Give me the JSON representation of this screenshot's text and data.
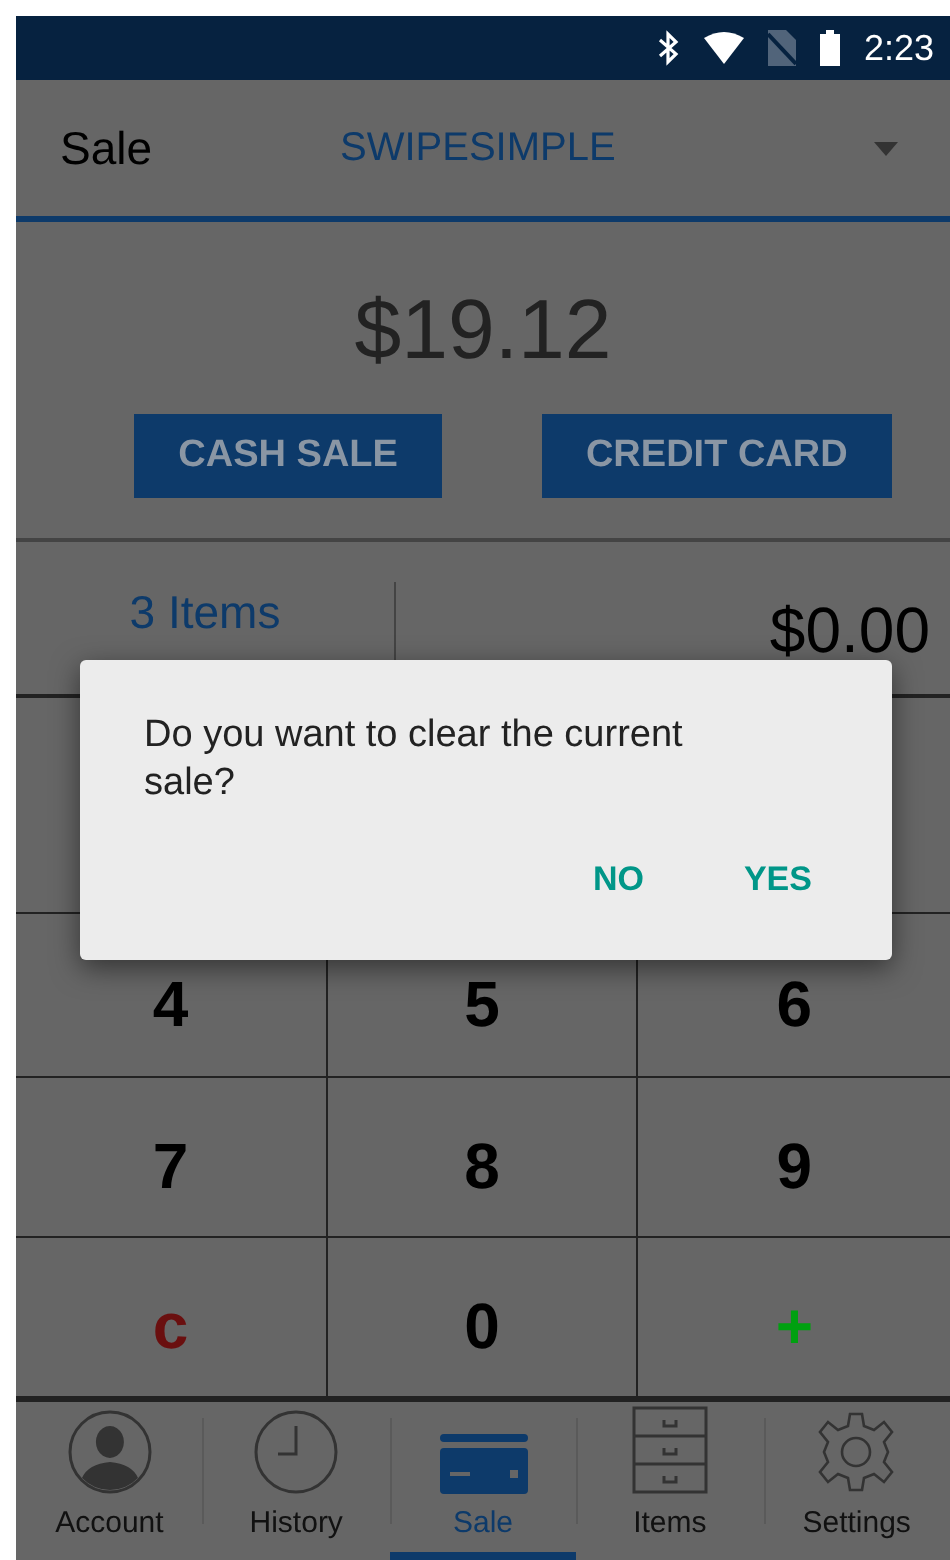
{
  "status_bar": {
    "time": "2:23"
  },
  "toolbar": {
    "title": "Sale",
    "account_selector": "SWIPESIMPLE"
  },
  "amount": "$19.12",
  "sale_buttons": [
    "CASH SALE",
    "CREDIT CARD"
  ],
  "summary": {
    "items": "3 Items",
    "total": "$0.00"
  },
  "keypad": [
    {
      "kind": "digit",
      "label": "4"
    },
    {
      "kind": "digit",
      "label": "5"
    },
    {
      "kind": "digit",
      "label": "6"
    },
    {
      "kind": "digit",
      "label": "7"
    },
    {
      "kind": "digit",
      "label": "8"
    },
    {
      "kind": "digit",
      "label": "9"
    },
    {
      "kind": "clear",
      "label": "c"
    },
    {
      "kind": "digit",
      "label": "0"
    },
    {
      "kind": "add",
      "label": "+"
    }
  ],
  "tabs": [
    {
      "kind": "account",
      "label": "Account",
      "selected": false
    },
    {
      "kind": "history",
      "label": "History",
      "selected": false
    },
    {
      "kind": "sale",
      "label": "Sale",
      "selected": true
    },
    {
      "kind": "items",
      "label": "Items",
      "selected": false
    },
    {
      "kind": "settings",
      "label": "Settings",
      "selected": false
    }
  ],
  "dialog": {
    "message": "Do you want to clear the current sale?",
    "buttons": [
      "NO",
      "YES"
    ]
  }
}
